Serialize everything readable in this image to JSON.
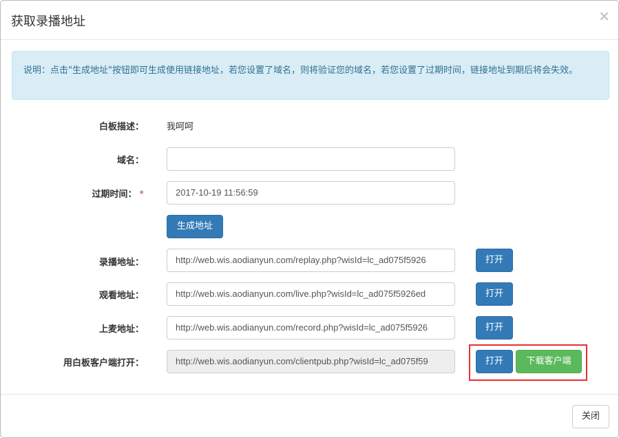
{
  "modal": {
    "title": "获取录播地址",
    "close_symbol": "×"
  },
  "alert": {
    "text": "说明：点击\"生成地址\"按钮即可生成使用链接地址，若您设置了域名，则将验证您的域名，若您设置了过期时间，链接地址到期后将会失效。"
  },
  "form": {
    "board_desc": {
      "label": "白板描述：",
      "value": "我呵呵"
    },
    "domain": {
      "label": "域名：",
      "value": ""
    },
    "expire": {
      "label": "过期时间：",
      "required_mark": "*",
      "value": "2017-10-19 11:56:59"
    },
    "generate_button": "生成地址",
    "replay": {
      "label": "录播地址：",
      "value": "http://web.wis.aodianyun.com/replay.php?wisId=lc_ad075f5926",
      "open_button": "打开"
    },
    "live": {
      "label": "观看地址：",
      "value": "http://web.wis.aodianyun.com/live.php?wisId=lc_ad075f5926ed",
      "open_button": "打开"
    },
    "record": {
      "label": "上麦地址：",
      "value": "http://web.wis.aodianyun.com/record.php?wisId=lc_ad075f5926",
      "open_button": "打开"
    },
    "client": {
      "label": "用白板客户端打开：",
      "value": "http://web.wis.aodianyun.com/clientpub.php?wisId=lc_ad075f59",
      "open_button": "打开",
      "download_button": "下载客户端"
    }
  },
  "footer": {
    "close_button": "关闭"
  },
  "colors": {
    "primary": "#337ab7",
    "success": "#5cb85c",
    "alert_bg": "#d9edf7",
    "alert_text": "#31708f",
    "highlight": "#e5302f"
  }
}
